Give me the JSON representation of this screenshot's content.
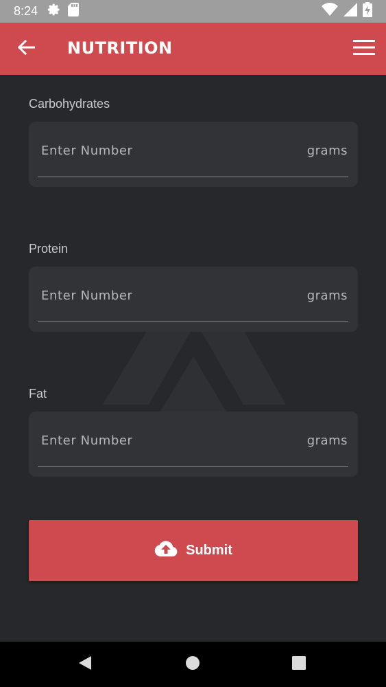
{
  "status_bar": {
    "time": "8:24",
    "icons_left": [
      "settings-icon",
      "sd-card-icon"
    ],
    "icons_right": [
      "wifi-icon",
      "signal-icon",
      "battery-charging-icon"
    ]
  },
  "app_bar": {
    "title": "NUTRITION",
    "color": "#cf4a4e"
  },
  "form": {
    "fields": [
      {
        "label": "Carbohydrates",
        "placeholder": "Enter Number",
        "value": "",
        "unit": "grams"
      },
      {
        "label": "Protein",
        "placeholder": "Enter Number",
        "value": "",
        "unit": "grams"
      },
      {
        "label": "Fat",
        "placeholder": "Enter Number",
        "value": "",
        "unit": "grams"
      }
    ],
    "submit_label": "Submit"
  },
  "nav_bar": {
    "buttons": [
      "back-triangle-icon",
      "home-circle-icon",
      "recents-square-icon"
    ]
  }
}
